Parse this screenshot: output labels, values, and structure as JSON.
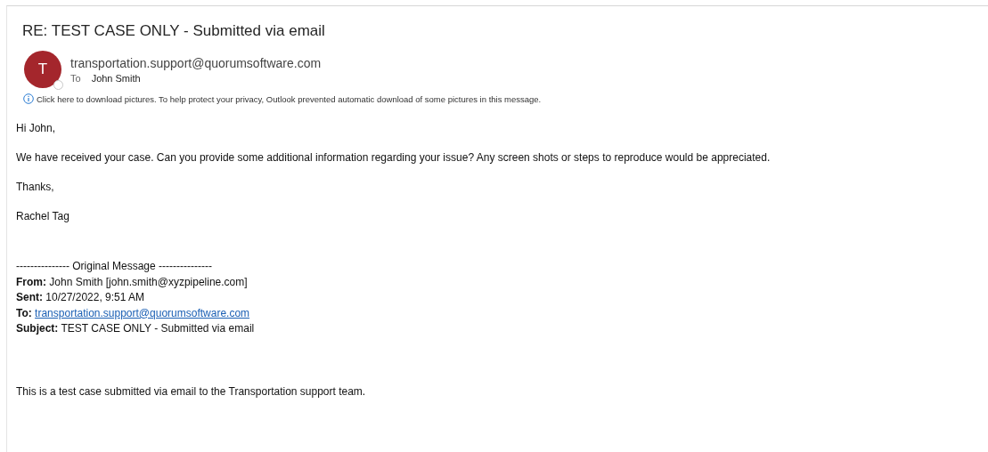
{
  "subject": "RE: TEST CASE ONLY - Submitted via email",
  "sender": {
    "avatar_letter": "T",
    "address": "transportation.support@quorumsoftware.com",
    "to_label": "To",
    "to_name": "John Smith"
  },
  "info_bar": {
    "text": "Click here to download pictures. To help protect your privacy, Outlook prevented automatic download of some pictures in this message."
  },
  "body": [
    "Hi John,",
    "We have received your case. Can you provide some additional information regarding your issue? Any screen shots or steps to reproduce would be appreciated.",
    "Thanks,",
    "Rachel Tag"
  ],
  "original_message": {
    "separator": "--------------- Original Message ---------------",
    "headers": [
      {
        "label": "From:",
        "value": "John Smith [john.smith@xyzpipeline.com]",
        "kind": "text"
      },
      {
        "label": "Sent:",
        "value": "10/27/2022, 9:51 AM",
        "kind": "text"
      },
      {
        "label": "To:",
        "value": "transportation.support@quorumsoftware.com",
        "kind": "link"
      },
      {
        "label": "Subject:",
        "value": "TEST CASE ONLY - Submitted via email",
        "kind": "text"
      }
    ],
    "body": "This is a test case submitted via email to the Transportation support team."
  }
}
